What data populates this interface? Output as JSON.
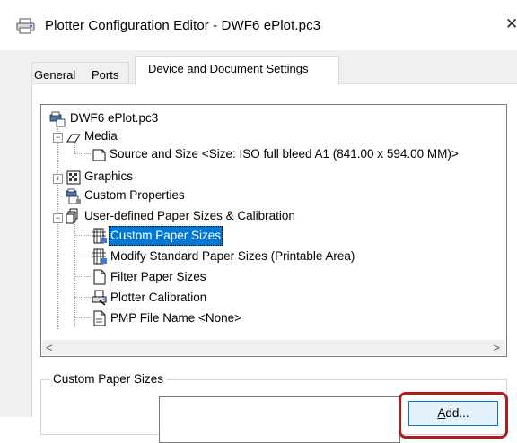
{
  "window": {
    "title": "Plotter Configuration Editor - DWF6 ePlot.pc3",
    "close_glyph": "✕",
    "app_icon": "plotter-icon"
  },
  "tabs": [
    {
      "label": "General",
      "selected": false
    },
    {
      "label": "Ports",
      "selected": false
    },
    {
      "label": "Device and Document Settings",
      "selected": true
    }
  ],
  "tree": {
    "root": {
      "label": "DWF6 ePlot.pc3",
      "icon": "plotter-config-icon"
    },
    "media": {
      "label": "Media",
      "icon": "media-icon",
      "expanded": true
    },
    "source_size": {
      "label": "Source and Size <Size: ISO full bleed A1 (841.00 x 594.00 MM)>",
      "icon": "paper-icon"
    },
    "graphics": {
      "label": "Graphics",
      "icon": "graphics-icon",
      "expanded": false
    },
    "custom_properties": {
      "label": "Custom Properties",
      "icon": "custom-properties-icon"
    },
    "user_defined": {
      "label": "User-defined Paper Sizes & Calibration",
      "icon": "paper-stack-icon",
      "expanded": true
    },
    "custom_paper_sizes": {
      "label": "Custom Paper Sizes",
      "icon": "custom-paper-icon",
      "selected": true
    },
    "modify_standard": {
      "label": "Modify Standard Paper Sizes (Printable Area)",
      "icon": "modify-paper-icon"
    },
    "filter_paper": {
      "label": "Filter Paper Sizes",
      "icon": "filter-paper-icon"
    },
    "plotter_calibration": {
      "label": "Plotter Calibration",
      "icon": "calibration-icon"
    },
    "pmp_file": {
      "label": "PMP File Name <None>",
      "icon": "pmp-file-icon"
    }
  },
  "scrollbar": {
    "left": "<",
    "right": ">"
  },
  "group": {
    "legend": "Custom Paper Sizes",
    "add_button": {
      "underlined": "A",
      "rest": "dd..."
    }
  },
  "colors": {
    "selection": "#0078d7",
    "highlight_ring": "#b31b1b",
    "button_face": "#e5f1fb"
  }
}
